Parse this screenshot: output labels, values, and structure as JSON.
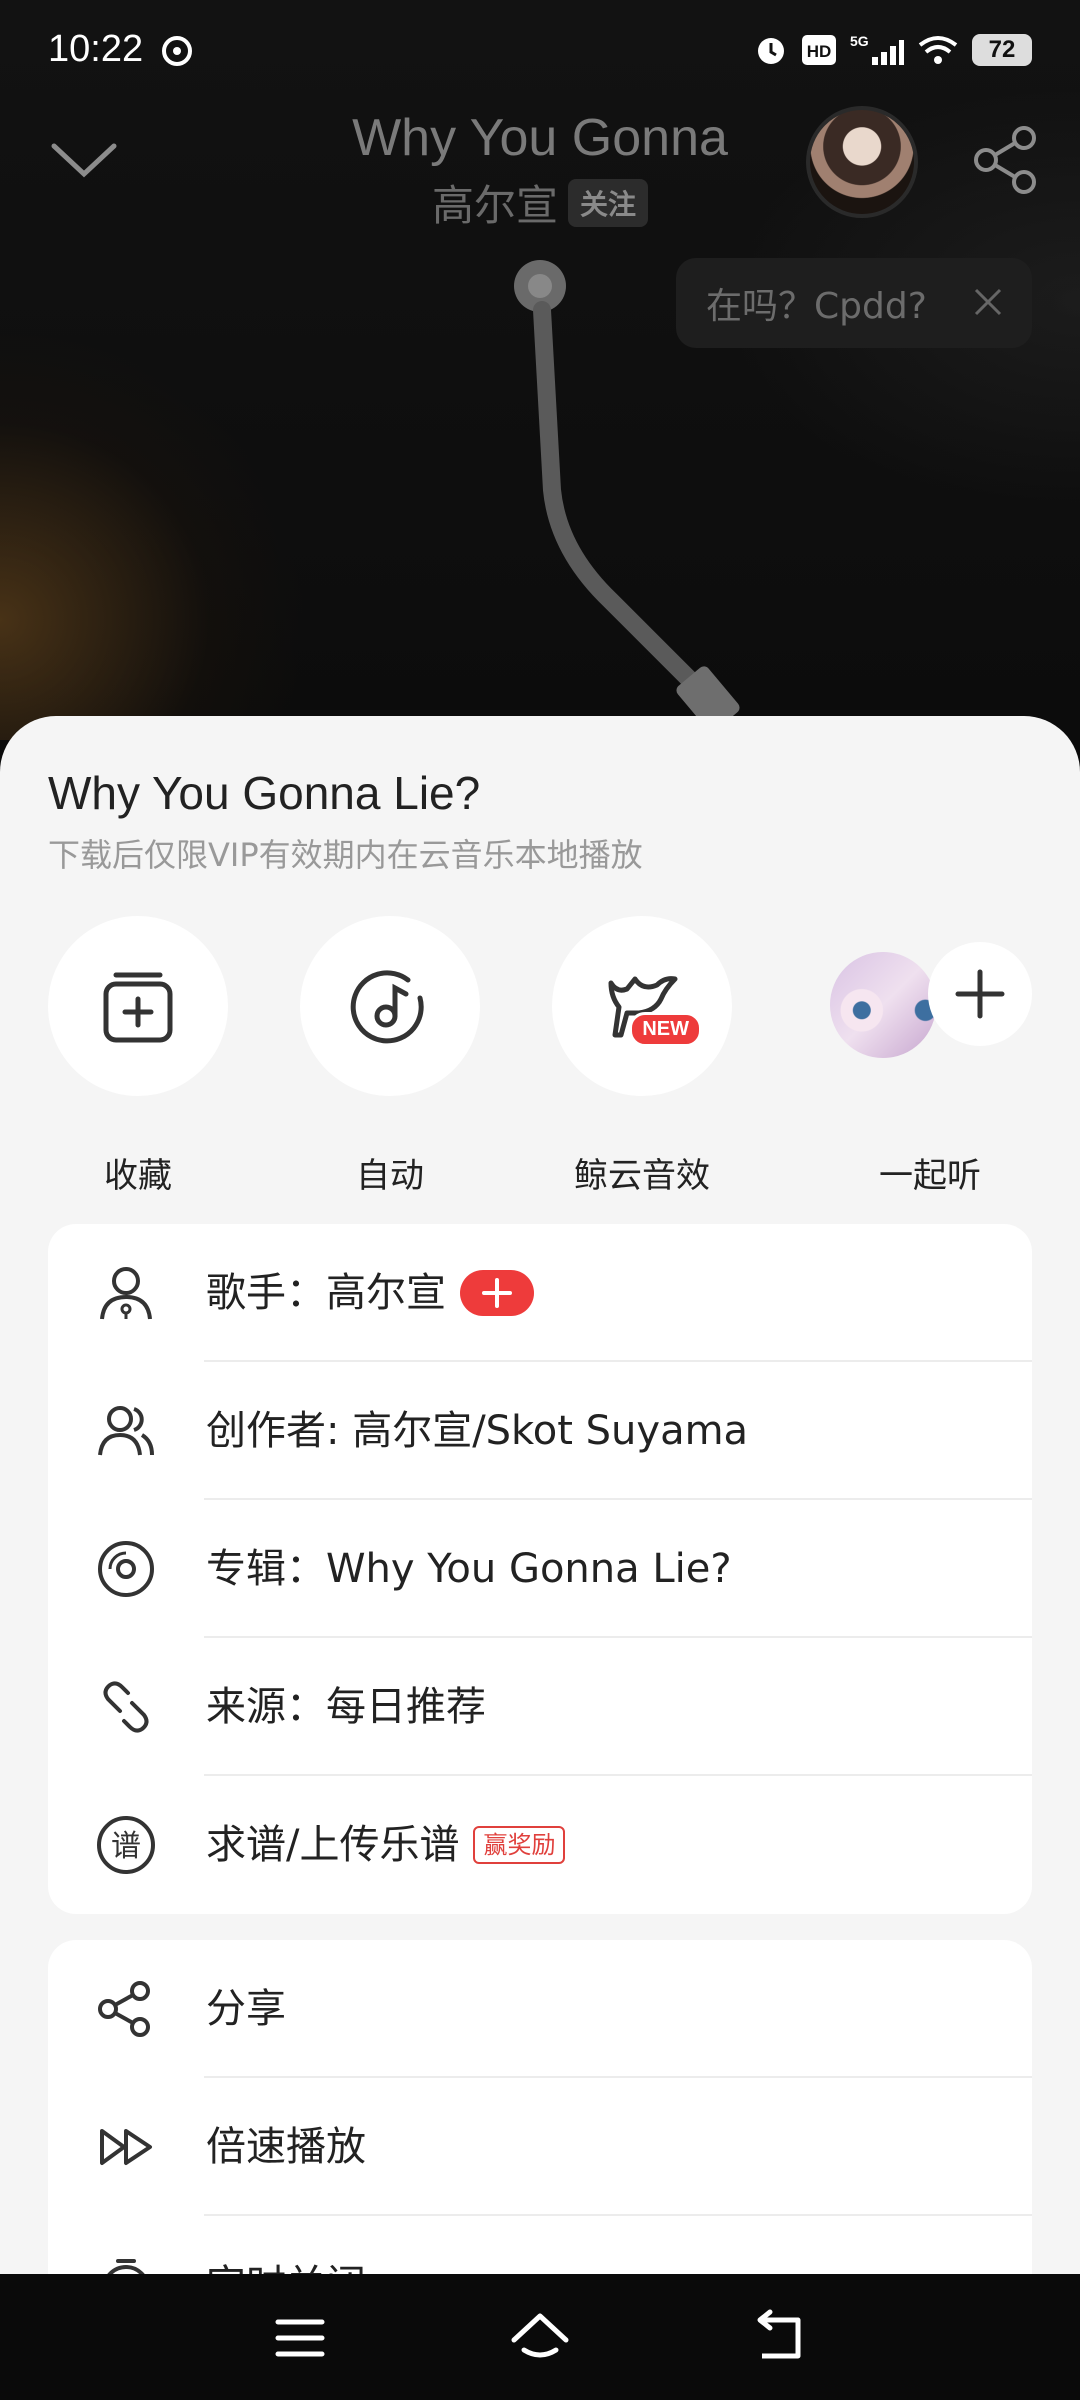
{
  "status_bar": {
    "time": "10:22",
    "battery": "72",
    "net": "5G"
  },
  "player": {
    "song_title": "Why You Gonna",
    "artist": "高尔宣",
    "follow_label": "关注",
    "bubble_text": "在吗？Cpdd?"
  },
  "sheet": {
    "title": "Why You Gonna Lie?",
    "subtitle": "下载后仅限VIP有效期内在云音乐本地播放",
    "actions": [
      {
        "label": "收藏",
        "icon": "add-to-collection-icon"
      },
      {
        "label": "自动",
        "icon": "music-note-icon"
      },
      {
        "label": "鲸云音效",
        "icon": "whale-sound-icon",
        "badge": "NEW"
      },
      {
        "label": "一起听",
        "icon": "listen-together-icon"
      }
    ],
    "info_rows": [
      {
        "label": "歌手：高尔宣",
        "icon": "singer-icon"
      },
      {
        "label": "创作者: 高尔宣/Skot Suyama",
        "icon": "creators-icon"
      },
      {
        "label": "专辑：Why You Gonna Lie?",
        "icon": "album-icon"
      },
      {
        "label": "来源：每日推荐",
        "icon": "link-icon"
      },
      {
        "label": "求谱/上传乐谱",
        "icon": "sheet-music-icon",
        "tag": "赢奖励"
      }
    ],
    "more_rows": [
      {
        "label": "分享",
        "icon": "share-icon"
      },
      {
        "label": "倍速播放",
        "icon": "speed-icon"
      },
      {
        "label": "定时关闭",
        "icon": "timer-icon"
      }
    ]
  },
  "colors": {
    "accent": "#ee3b3b",
    "sheet_bg": "#f5f5f5"
  }
}
